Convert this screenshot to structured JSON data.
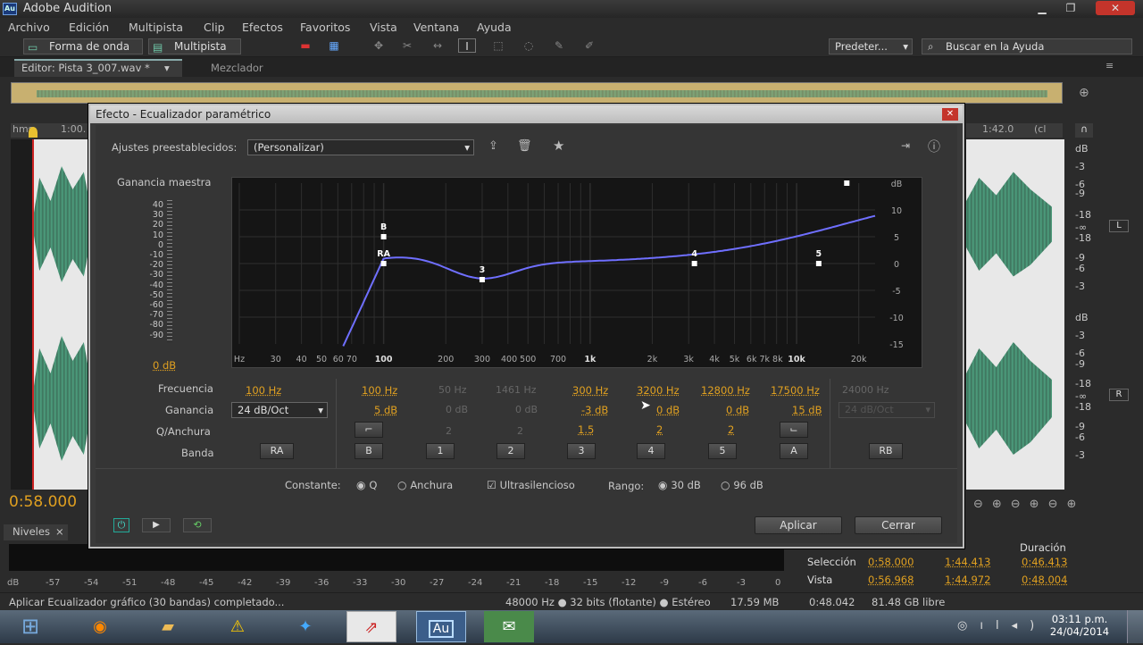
{
  "titlebar": {
    "app_title": "Adobe Audition",
    "logo": "Au"
  },
  "menu": [
    "Archivo",
    "Edición",
    "Multipista",
    "Clip",
    "Efectos",
    "Favoritos",
    "Vista",
    "Ventana",
    "Ayuda"
  ],
  "toolbar": {
    "waveform_label": "Forma de onda",
    "multitrack_label": "Multipista",
    "preset_label": "Predeter...",
    "help_placeholder": "Buscar en la Ayuda"
  },
  "tabs": {
    "editor": "Editor: Pista 3_007.wav *",
    "mixer": "Mezclador"
  },
  "timeline": {
    "ruler_left": "hms",
    "ruler_mark": "1:00.",
    "ruler_right": "1:42.0",
    "ruler_right2": "(cl",
    "time_display": "0:58.000"
  },
  "db_scale_right_top": [
    "dB",
    "-3",
    "-6",
    "-9",
    "-18",
    "-∞",
    "-18",
    "-9",
    "-6",
    "-3"
  ],
  "db_scale_right_bottom": [
    "dB",
    "-3",
    "-6",
    "-9",
    "-18",
    "-∞",
    "-18",
    "-9",
    "-6",
    "-3"
  ],
  "channel_labels": {
    "left": "L",
    "right": "R"
  },
  "dialog": {
    "title": "Efecto - Ecualizador paramétrico",
    "presets_label": "Ajustes preestablecidos:",
    "preset_value": "(Personalizar)",
    "master_gain_label": "Ganancia maestra",
    "master_gain_value": "0 dB",
    "master_scale": [
      "40",
      "30",
      "20",
      "10",
      "0",
      "-10",
      "-20",
      "-30",
      "-40",
      "-50",
      "-60",
      "-70",
      "-80",
      "-90"
    ],
    "freq_axis": [
      "Hz",
      "30",
      "40",
      "50",
      "60 70",
      "100",
      "200",
      "300",
      "400 500",
      "700",
      "1k",
      "2k",
      "3k",
      "4k",
      "5k",
      "6k 7k 8k",
      "10k",
      "20k"
    ],
    "db_axis": [
      "dB",
      "10",
      "5",
      "0",
      "-5",
      "-10",
      "-15"
    ],
    "rows": {
      "freq": "Frecuencia",
      "gain": "Ganancia",
      "q": "Q/Anchura",
      "band": "Banda"
    },
    "slope_value": "24 dB/Oct",
    "slope_value_disabled": "24 dB/Oct",
    "bands": [
      {
        "band": "RA",
        "freq": "100 Hz",
        "gain": "",
        "q": "",
        "active": true
      },
      {
        "band": "B",
        "freq": "100 Hz",
        "gain": "5 dB",
        "q": "",
        "active": true
      },
      {
        "band": "1",
        "freq": "50 Hz",
        "gain": "0 dB",
        "q": "2",
        "active": false
      },
      {
        "band": "2",
        "freq": "1461 Hz",
        "gain": "0 dB",
        "q": "2",
        "active": false
      },
      {
        "band": "3",
        "freq": "300 Hz",
        "gain": "-3 dB",
        "q": "1.5",
        "active": true
      },
      {
        "band": "4",
        "freq": "3200 Hz",
        "gain": "0 dB",
        "q": "2",
        "active": true
      },
      {
        "band": "5",
        "freq": "12800 Hz",
        "gain": "0 dB",
        "q": "2",
        "active": true
      },
      {
        "band": "A",
        "freq": "17500 Hz",
        "gain": "15 dB",
        "q": "",
        "active": true
      },
      {
        "band": "RB",
        "freq": "24000 Hz",
        "gain": "",
        "q": "",
        "active": false
      }
    ],
    "graph_points": [
      {
        "label": "B",
        "freq": 100,
        "gain": 5
      },
      {
        "label": "RA",
        "freq": 100,
        "gain": 0
      },
      {
        "label": "3",
        "freq": 300,
        "gain": -3
      },
      {
        "label": "4",
        "freq": 3200,
        "gain": 0
      },
      {
        "label": "5",
        "freq": 12800,
        "gain": 0
      },
      {
        "label": "",
        "freq": 17500,
        "gain": 15
      }
    ],
    "constant_label": "Constante:",
    "opt_q": "Q",
    "opt_width": "Anchura",
    "ultra_label": "Ultrasilencioso",
    "range_label": "Rango:",
    "range_30": "30 dB",
    "range_96": "96 dB",
    "apply": "Aplicar",
    "close": "Cerrar"
  },
  "levels": {
    "title": "Niveles",
    "scale": [
      "dB",
      "-57",
      "-54",
      "-51",
      "-48",
      "-45",
      "-42",
      "-39",
      "-36",
      "-33",
      "-30",
      "-27",
      "-24",
      "-21",
      "-18",
      "-15",
      "-12",
      "-9",
      "-6",
      "-3",
      "0"
    ]
  },
  "selection": {
    "col_duration": "Duración",
    "row1_label": "Selección",
    "row1_start": "0:58.000",
    "row1_end": "1:44.413",
    "row1_dur": "0:46.413",
    "row2_label": "Vista",
    "row2_start": "0:56.968",
    "row2_end": "1:44.972",
    "row2_dur": "0:48.004"
  },
  "status": {
    "message": "Aplicar Ecualizador gráfico (30 bandas) completado...",
    "format": "48000 Hz ● 32 bits (flotante) ● Estéreo",
    "size": "17.59 MB",
    "duration": "0:48.042",
    "free": "81.48 GB libre"
  },
  "taskbar": {
    "time": "03:11 p.m.",
    "date": "24/04/2014"
  },
  "colors": {
    "accent": "#e0a020",
    "curve": "#6f6fff",
    "wave": "#2d7a5e"
  }
}
